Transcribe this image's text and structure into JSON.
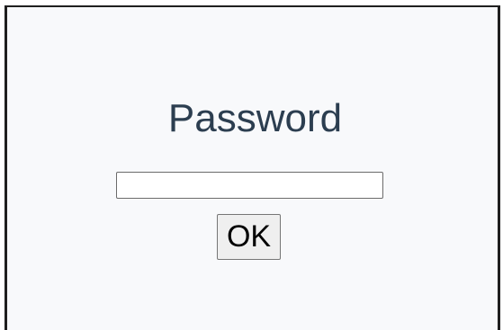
{
  "dialog": {
    "title": "Password",
    "password_value": "",
    "ok_label": "OK"
  }
}
